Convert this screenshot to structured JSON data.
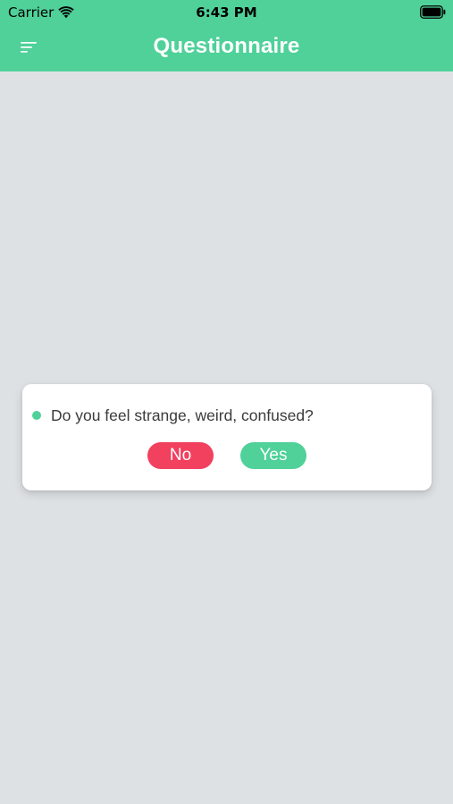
{
  "status_bar": {
    "carrier": "Carrier",
    "time": "6:43 PM"
  },
  "nav": {
    "title": "Questionnaire",
    "menu_icon": "menu-icon"
  },
  "question": {
    "text": "Do you feel strange, weird, confused?",
    "answers": {
      "no_label": "No",
      "yes_label": "Yes"
    }
  },
  "colors": {
    "header": "#4fd199",
    "background": "#dde1e4",
    "no_button": "#f2405f",
    "yes_button": "#4fd199",
    "bullet": "#4fd199"
  }
}
